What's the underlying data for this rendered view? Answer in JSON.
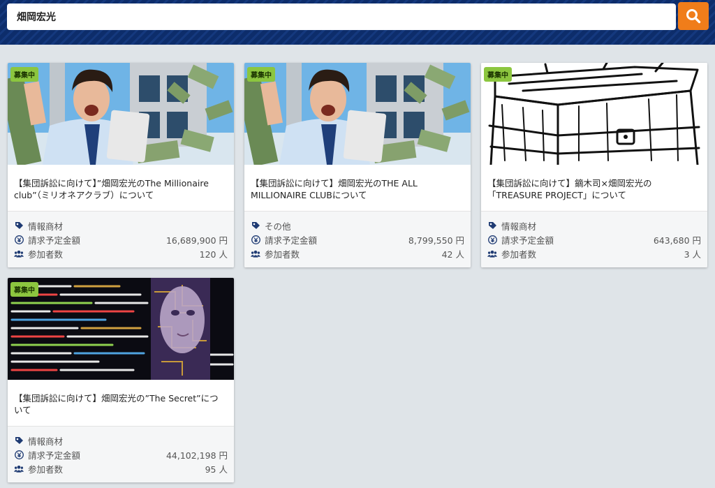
{
  "search": {
    "value": "畑岡宏光",
    "placeholder": ""
  },
  "colors": {
    "header": "#0d2d6b",
    "accent": "#f07d1a",
    "badge": "#8cc63f"
  },
  "cards": [
    {
      "badge": "募集中",
      "title": "【集団訴訟に向けて】”畑岡宏光のThe Millionaire club”（ミリオネアクラブ）について",
      "category": "情報商材",
      "amount_label": "請求予定金額",
      "amount": "16,689,900 円",
      "participants_label": "参加者数",
      "participants": "120 人",
      "image": "businessman-money-image"
    },
    {
      "badge": "募集中",
      "title": "【集団訴訟に向けて】畑岡宏光のTHE ALL MILLIONAIRE CLUBについて",
      "category": "その他",
      "amount_label": "請求予定金額",
      "amount": "8,799,550 円",
      "participants_label": "参加者数",
      "participants": "42 人",
      "image": "businessman-money-image"
    },
    {
      "badge": "募集中",
      "title": "【集団訴訟に向けて】鏑木司×畑岡宏光の「TREASURE PROJECT」について",
      "category": "情報商材",
      "amount_label": "請求予定金額",
      "amount": "643,680 円",
      "participants_label": "参加者数",
      "participants": "3 人",
      "image": "treasure-chest-sketch-image"
    },
    {
      "badge": "募集中",
      "title": "【集団訴訟に向けて】畑岡宏光の”The Secret”について",
      "category": "情報商材",
      "amount_label": "請求予定金額",
      "amount": "44,102,198 円",
      "participants_label": "参加者数",
      "participants": "95 人",
      "image": "code-cyborg-image"
    }
  ]
}
